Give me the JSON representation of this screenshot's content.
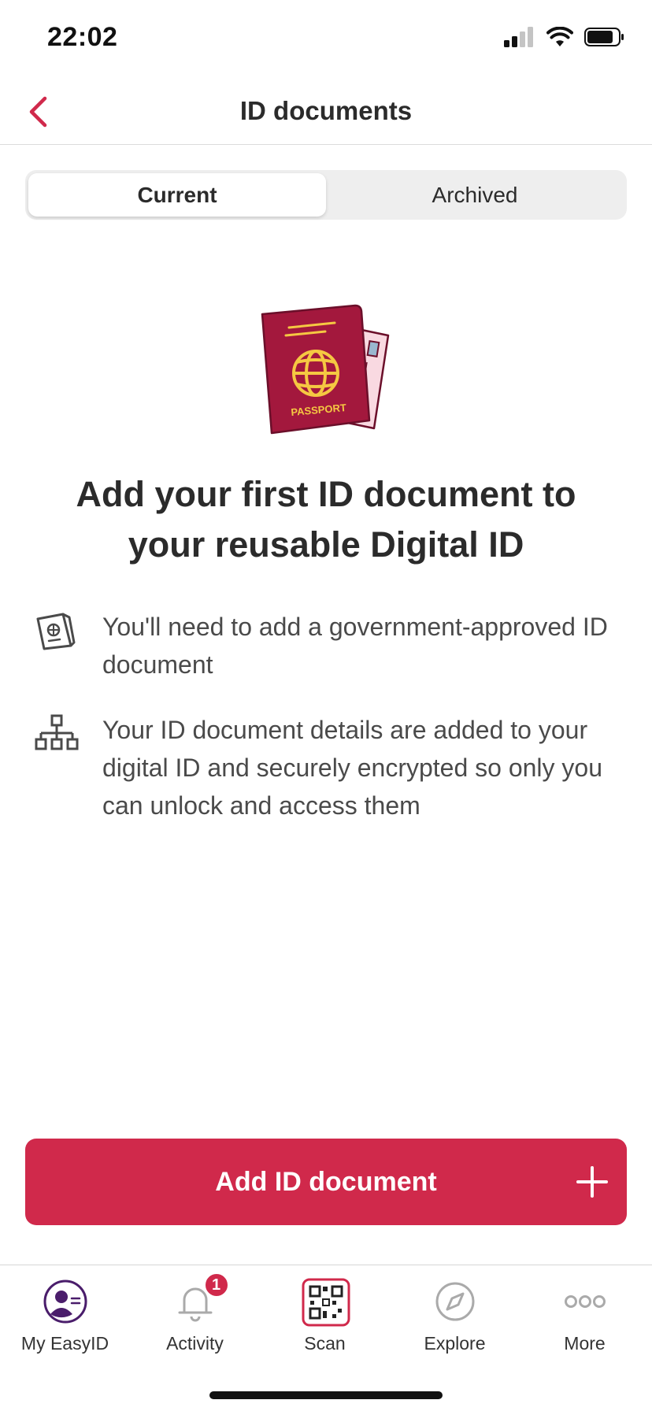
{
  "status_bar": {
    "time": "22:02"
  },
  "nav": {
    "title": "ID documents"
  },
  "segments": {
    "current": "Current",
    "archived": "Archived"
  },
  "illustration": {
    "passport_text": "PASSPORT"
  },
  "empty_state": {
    "headline": "Add your first ID document to your reusable Digital ID",
    "items": [
      {
        "icon": "passport-outline-icon",
        "text": "You'll need to add a government-approved ID document"
      },
      {
        "icon": "hierarchy-icon",
        "text": "Your ID document details are added to your digital ID and securely encrypted so only you can unlock and access them"
      }
    ]
  },
  "cta": {
    "label": "Add ID document"
  },
  "tabs": [
    {
      "label": "My EasyID",
      "icon": "profile-icon"
    },
    {
      "label": "Activity",
      "icon": "bell-icon",
      "badge": "1"
    },
    {
      "label": "Scan",
      "icon": "qr-code-icon"
    },
    {
      "label": "Explore",
      "icon": "compass-icon"
    },
    {
      "label": "More",
      "icon": "more-icon"
    }
  ],
  "colors": {
    "accent": "#d0294b",
    "passport": "#a3183d",
    "gold": "#f5c842"
  }
}
